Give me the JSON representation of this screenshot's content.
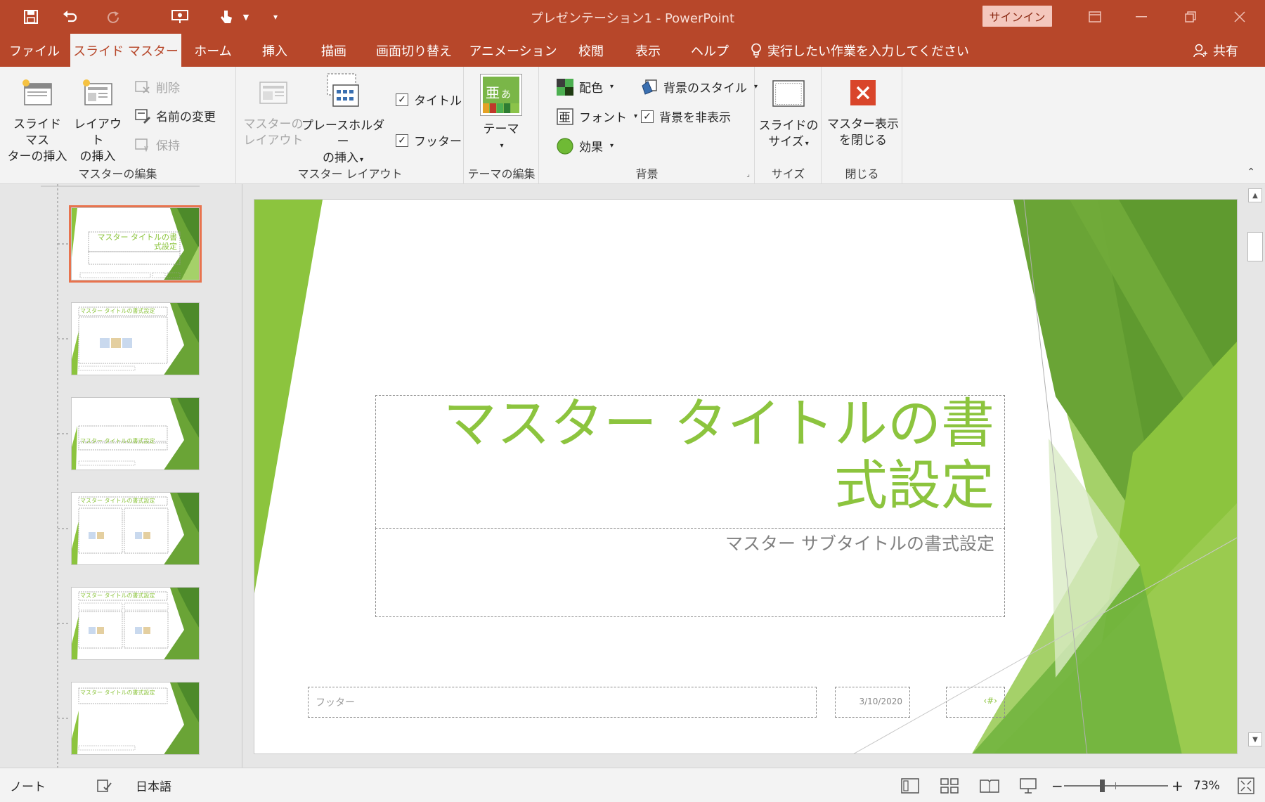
{
  "titlebar": {
    "title": "プレゼンテーション1  -  PowerPoint",
    "signin": "サインイン",
    "qat": [
      "save-icon",
      "undo-icon",
      "redo-icon",
      "present-icon",
      "touch-mode-icon",
      "customize-icon"
    ]
  },
  "tabs": [
    {
      "label": "ファイル"
    },
    {
      "label": "スライド マスター"
    },
    {
      "label": "ホーム"
    },
    {
      "label": "挿入"
    },
    {
      "label": "描画"
    },
    {
      "label": "画面切り替え"
    },
    {
      "label": "アニメーション"
    },
    {
      "label": "校閲"
    },
    {
      "label": "表示"
    },
    {
      "label": "ヘルプ"
    }
  ],
  "tellme": "実行したい作業を入力してください",
  "share": "共有",
  "ribbon": {
    "edit_master": {
      "label": "マスターの編集",
      "insert_master": "スライド マス\nターの挿入",
      "insert_layout": "レイアウト\nの挿入",
      "delete": "削除",
      "rename": "名前の変更",
      "preserve": "保持"
    },
    "master_layout": {
      "label": "マスター レイアウト",
      "master_layout_btn": "マスターの\nレイアウト",
      "insert_placeholder": "プレースホルダー\nの挿入",
      "title": "タイトル",
      "footer": "フッター"
    },
    "edit_theme": {
      "label": "テーマの編集",
      "themes": "テーマ"
    },
    "background": {
      "label": "背景",
      "colors": "配色",
      "fonts": "フォント",
      "effects": "効果",
      "background_styles": "背景のスタイル",
      "hide_background": "背景を非表示"
    },
    "size": {
      "label": "サイズ",
      "slide_size": "スライドの\nサイズ"
    },
    "close": {
      "label": "閉じる",
      "close_master": "マスター表示\nを閉じる"
    }
  },
  "slide": {
    "title": "マスター タイトルの書式設定",
    "subtitle": "マスター サブタイトルの書式設定",
    "footer": "フッター",
    "date": "3/10/2020",
    "number": "‹#›"
  },
  "thumbnails": [
    {
      "title": "マスター タイトルの書式設定",
      "selected": true
    },
    {
      "title": "マスター タイトルの書式設定",
      "selected": false
    },
    {
      "title": "マスター タイトルの書式設定",
      "selected": false
    },
    {
      "title": "マスター タイトルの書式設定",
      "selected": false
    },
    {
      "title": "マスター タイトルの書式設定",
      "selected": false
    },
    {
      "title": "マスター タイトルの書式設定",
      "selected": false
    }
  ],
  "statusbar": {
    "notes": "ノート",
    "language": "日本語",
    "zoom": "73%",
    "zoom_minus": "−",
    "zoom_plus": "+"
  },
  "colors": {
    "accent": "#b7472a",
    "green": "#8cc43e",
    "green_dark": "#5f9a2f"
  }
}
